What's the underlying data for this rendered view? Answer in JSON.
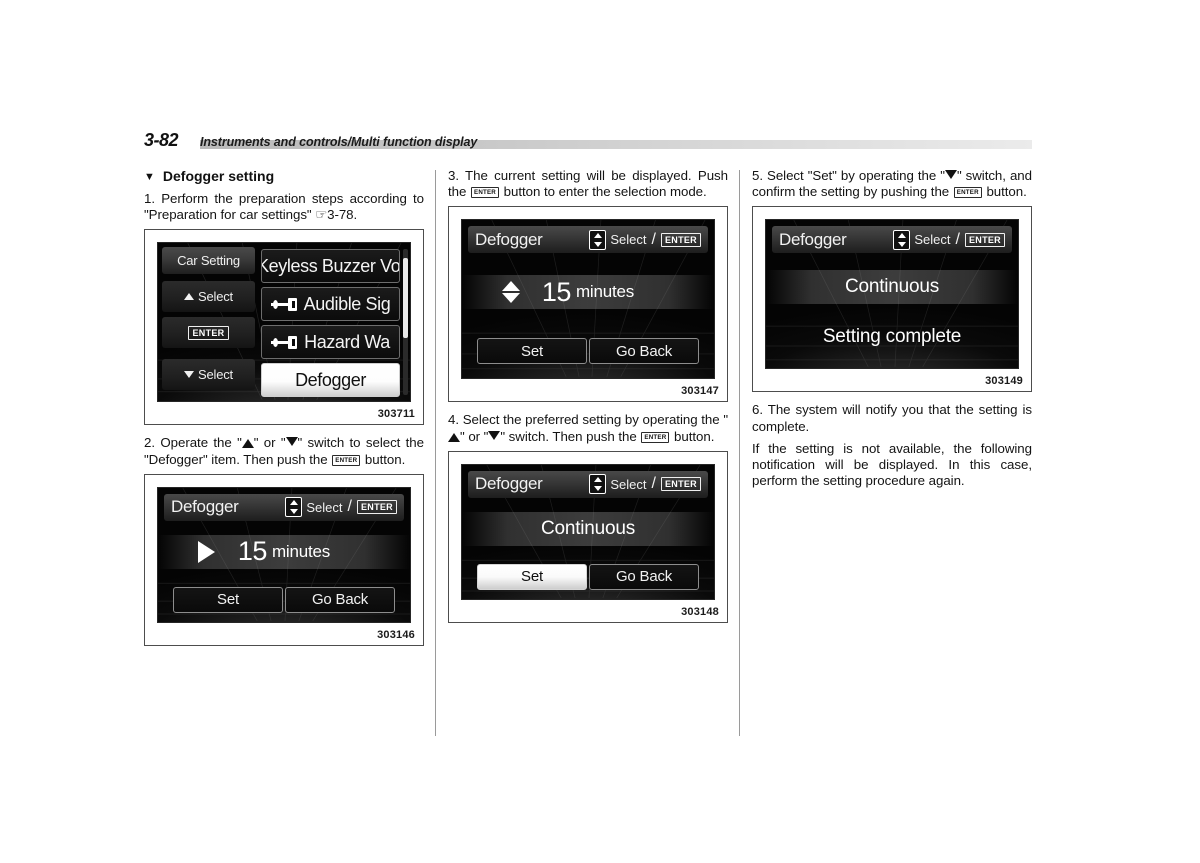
{
  "header": {
    "page_number": "3-82",
    "title": "Instruments and controls/Multi function display"
  },
  "section": {
    "bullet": "▼",
    "heading": "Defogger setting"
  },
  "steps": {
    "s1": "1.  Perform the preparation steps according to \"Preparation for car settings\" ☞3-78.",
    "s2_a": "2.  Operate the \"",
    "s2_b": "\" or \"",
    "s2_c": "\" switch to select the \"Defogger\" item. Then push the",
    "s2_enter": "ENTER",
    "s2_d": "button.",
    "s3": "3.  The current setting will be displayed. Push the",
    "s3_enter": "ENTER",
    "s3_b": "button to enter the selection mode.",
    "s4_a": "4.  Select the preferred setting by operating the \"",
    "s4_b": "\" or \"",
    "s4_c": "\" switch. Then push the",
    "s4_enter": "ENTER",
    "s4_d": "button.",
    "s5_a": "5.  Select \"Set\" by operating the \"",
    "s5_b": "\" switch, and confirm the setting by pushing the",
    "s5_enter": "ENTER",
    "s5_c": "button.",
    "s6": "6.  The system will notify you that the setting is complete.",
    "s6_note": "If the setting is not available, the following notification will be displayed. In this case, perform the setting procedure again."
  },
  "figures": {
    "fig1": {
      "id": "303711",
      "left_panel": {
        "title_chip": "Car Setting",
        "up_select": "Select",
        "enter": "ENTER",
        "down_select": "Select"
      },
      "menu_items": [
        {
          "label": "Keyless Buzzer Vol",
          "icon": "none",
          "selected": false
        },
        {
          "label": "Audible Sig",
          "icon": "key-icon",
          "selected": false
        },
        {
          "label": "Hazard Wa",
          "icon": "key-icon",
          "selected": false
        },
        {
          "label": "Defogger",
          "icon": "none",
          "selected": true
        }
      ]
    },
    "fig2": {
      "id": "303146",
      "title": "Defogger",
      "hint_select": "Select",
      "hint_enter": "ENTER",
      "marker": "right-arrow",
      "value": "15",
      "unit": "minutes",
      "btn_set": "Set",
      "btn_set_active": false,
      "btn_back": "Go Back"
    },
    "fig3": {
      "id": "303147",
      "title": "Defogger",
      "hint_select": "Select",
      "hint_enter": "ENTER",
      "marker": "up-down-arrow",
      "value": "15",
      "unit": "minutes",
      "btn_set": "Set",
      "btn_set_active": false,
      "btn_back": "Go Back"
    },
    "fig4": {
      "id": "303148",
      "title": "Defogger",
      "hint_select": "Select",
      "hint_enter": "ENTER",
      "value": "Continuous",
      "btn_set": "Set",
      "btn_set_active": true,
      "btn_back": "Go Back"
    },
    "fig5": {
      "id": "303149",
      "title": "Defogger",
      "hint_select": "Select",
      "hint_enter": "ENTER",
      "value": "Continuous",
      "note": "Setting complete"
    }
  },
  "colors": {
    "lcd_background": "#040404",
    "lcd_text": "#f2f2f2",
    "highlight": "#ffffff",
    "rule": "#c9c9c9",
    "frame_border": "#4d4d4d"
  }
}
